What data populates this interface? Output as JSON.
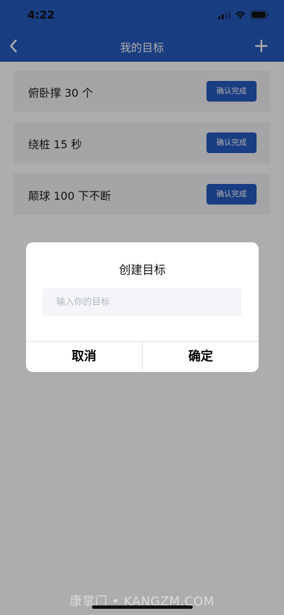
{
  "status_bar": {
    "time": "4:22"
  },
  "nav": {
    "title": "我的目标"
  },
  "goals": [
    {
      "text": "俯卧撑 30 个",
      "button": "确认完成"
    },
    {
      "text": "绕桩 15 秒",
      "button": "确认完成"
    },
    {
      "text": "颠球 100 下不断",
      "button": "确认完成"
    }
  ],
  "dialog": {
    "title": "创建目标",
    "input_placeholder": "输入你的目标",
    "input_value": "",
    "cancel_label": "取消",
    "confirm_label": "确定"
  },
  "watermark": "康掌门 • KANGZM.COM",
  "colors": {
    "primary": "#255bbe",
    "card_bg": "#f3f4f6",
    "overlay": "rgba(0,0,0,0.32)"
  }
}
